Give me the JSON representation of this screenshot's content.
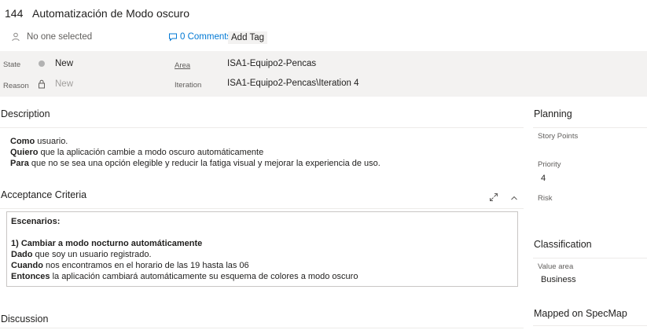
{
  "header": {
    "id": "144",
    "title": "Automatización de Modo oscuro",
    "assignee": "No one selected",
    "comments_label": "0 Comments",
    "add_tag_label": "Add Tag"
  },
  "fields": {
    "state_label": "State",
    "state_value": "New",
    "reason_label": "Reason",
    "reason_value": "New",
    "area_label": "Area",
    "area_value": "ISA1-Equipo2-Pencas",
    "iteration_label": "Iteration",
    "iteration_value": "ISA1-Equipo2-Pencas\\Iteration 4"
  },
  "description": {
    "title": "Description",
    "lines": [
      {
        "bold": "Como",
        "text": " usuario."
      },
      {
        "bold": "Quiero",
        "text": " que la aplicación cambie a modo oscuro automáticamente"
      },
      {
        "bold": "Para",
        "text": " que no se sea una opción elegible y reducir la fatiga visual y mejorar la experiencia de uso."
      }
    ]
  },
  "acceptance": {
    "title": "Acceptance Criteria",
    "heading": "Escenarios:",
    "scenario_title": "1) Cambiar a modo nocturno automáticamente",
    "lines": [
      {
        "bold": "Dado",
        "text": " que soy un usuario registrado."
      },
      {
        "bold": "Cuando",
        "text": " nos encontramos en el horario de las 19 hasta las 06"
      },
      {
        "bold": "Entonces",
        "text": " la aplicación cambiará automáticamente su esquema de colores a modo oscuro"
      }
    ]
  },
  "discussion": {
    "title": "Discussion"
  },
  "planning": {
    "title": "Planning",
    "story_points_label": "Story Points",
    "priority_label": "Priority",
    "priority_value": "4",
    "risk_label": "Risk"
  },
  "classification": {
    "title": "Classification",
    "value_area_label": "Value area",
    "value_area_value": "Business"
  },
  "mapped": {
    "title": "Mapped on SpecMap"
  },
  "icons": {
    "person": "person-icon",
    "comment": "comment-icon",
    "lock": "lock-icon",
    "expand": "expand-icon",
    "collapse": "chevron-up-icon"
  },
  "colors": {
    "link": "#0078d4",
    "band": "#f3f2f1",
    "state_dot": "#b2b2b2"
  }
}
